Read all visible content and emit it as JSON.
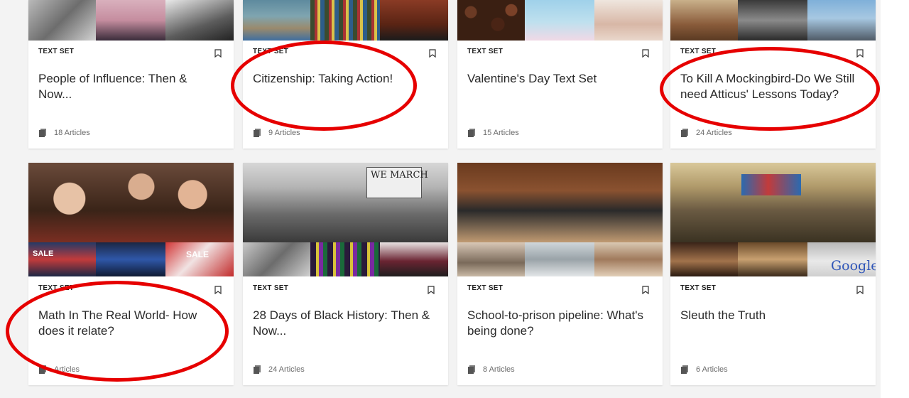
{
  "colors": {
    "accent_circle": "#e60000",
    "background": "#f3f3f3",
    "card": "#ffffff"
  },
  "cards": [
    {
      "label": "TEXT SET",
      "title": "People of Influence: Then & Now...",
      "articles": "18 Articles",
      "icon": "stack-icon"
    },
    {
      "label": "TEXT SET",
      "title": "Citizenship: Taking Action!",
      "articles": "9 Articles",
      "icon": "stack-icon"
    },
    {
      "label": "TEXT SET",
      "title": "Valentine's Day Text Set",
      "articles": "15 Articles",
      "icon": "stack-icon"
    },
    {
      "label": "TEXT SET",
      "title": "To Kill A Mockingbird-Do We Still need Atticus' Lessons Today?",
      "articles": "24 Articles",
      "icon": "stack-icon"
    },
    {
      "label": "TEXT SET",
      "title": "Math In The Real World- How does it relate?",
      "articles": "Articles",
      "icon": "stack-icon"
    },
    {
      "label": "TEXT SET",
      "title": "28 Days of Black History: Then & Now...",
      "articles": "24 Articles",
      "icon": "stack-icon"
    },
    {
      "label": "TEXT SET",
      "title": "School-to-prison pipeline: What's being done?",
      "articles": "8 Articles",
      "icon": "stack-icon"
    },
    {
      "label": "TEXT SET",
      "title": "Sleuth the Truth",
      "articles": "6 Articles",
      "icon": "stack-icon"
    }
  ],
  "thumb_text": {
    "march_sign": "WE MARCH",
    "sale": "SALE",
    "google": "Google"
  }
}
